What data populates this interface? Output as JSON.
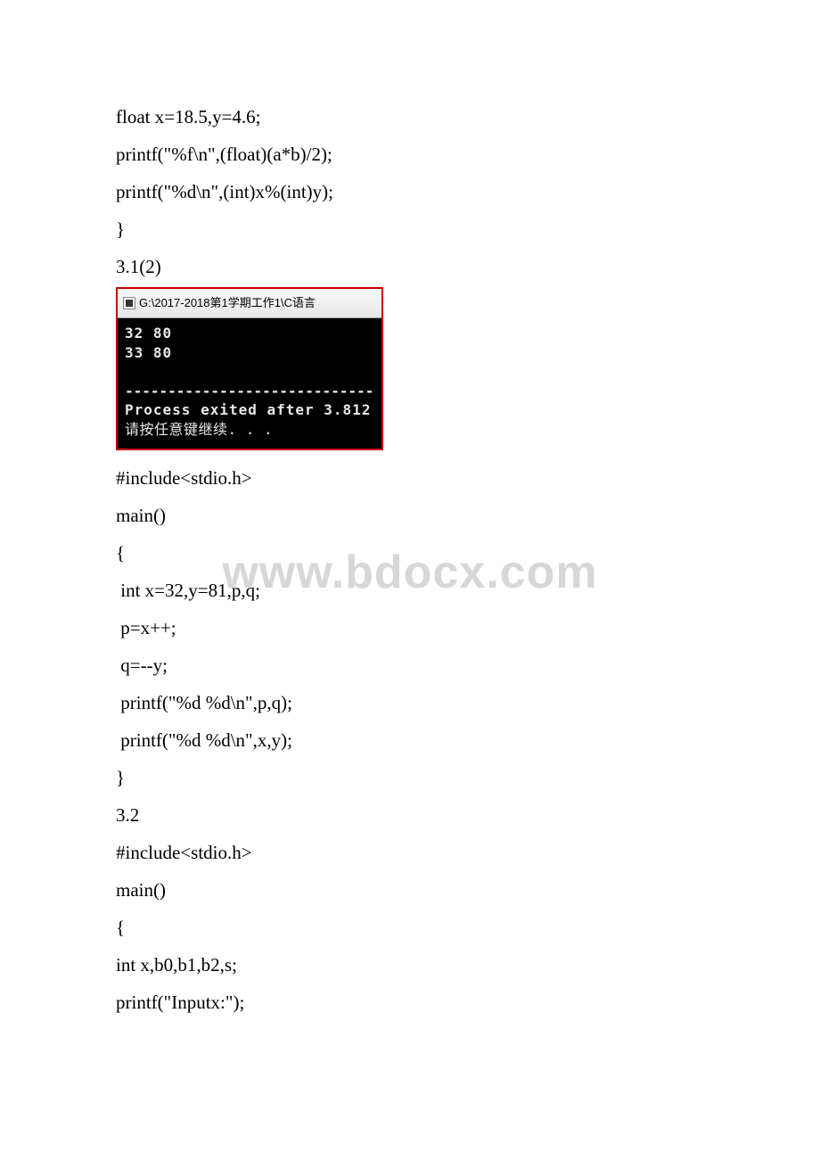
{
  "watermark": "www.bdocx.com",
  "code_before": [
    "float x=18.5,y=4.6;",
    "printf(\"%f\\n\",(float)(a*b)/2);",
    "printf(\"%d\\n\",(int)x%(int)y);",
    "}",
    "3.1(2)"
  ],
  "console": {
    "title": "G:\\2017-2018第1学期工作1\\C语言",
    "lines": [
      "32 80",
      "33 80"
    ],
    "separator": "-----------------------------",
    "exit_line": "Process exited after 3.812",
    "prompt": "请按任意键继续. . ."
  },
  "code_after": [
    "#include<stdio.h>",
    "main()",
    "{",
    " int x=32,y=81,p,q;",
    " p=x++;",
    " q=--y;",
    " printf(\"%d %d\\n\",p,q);",
    " printf(\"%d %d\\n\",x,y);",
    "}",
    "3.2",
    "#include<stdio.h>",
    "main()",
    "{",
    "int x,b0,b1,b2,s;",
    "printf(\"Inputx:\");"
  ]
}
